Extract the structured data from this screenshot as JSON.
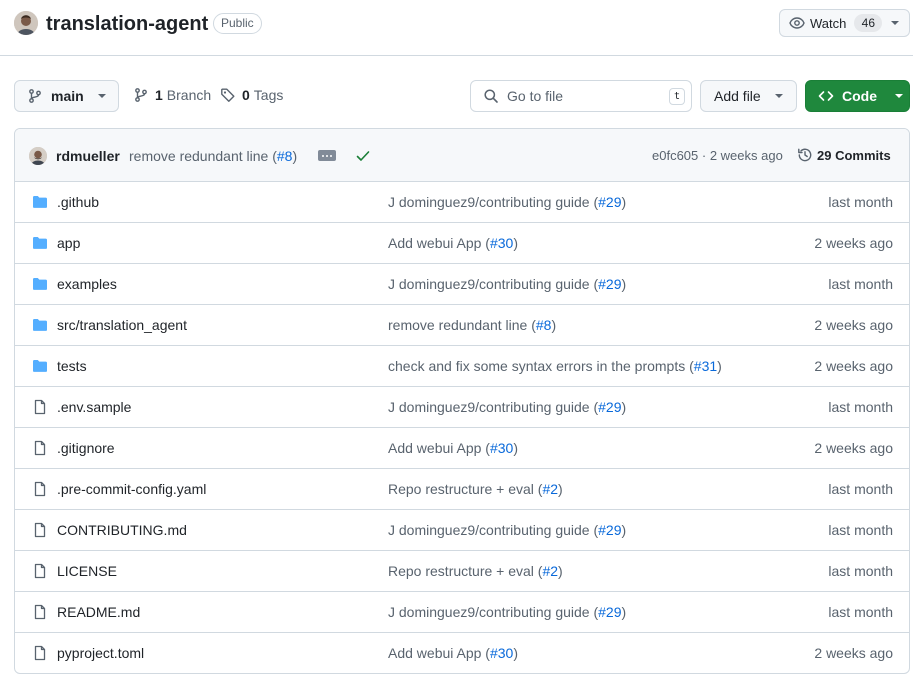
{
  "repo": {
    "name": "translation-agent",
    "visibility": "Public",
    "watch_label": "Watch",
    "watch_count": "46"
  },
  "toolbar": {
    "branch": "main",
    "branches_count": "1",
    "branches_label": "Branch",
    "tags_count": "0",
    "tags_label": "Tags",
    "search_placeholder": "Go to file",
    "search_shortcut": "t",
    "add_file_label": "Add file",
    "code_label": "Code"
  },
  "colors": {
    "accent_link": "#0969da",
    "code_button": "#1f883d",
    "success_check": "#1a7f37",
    "folder_icon": "#54aeff"
  },
  "latest_commit": {
    "author": "rdmueller",
    "message": "remove redundant line (",
    "pr": "#8",
    "message_end": ")",
    "hash_time": "e0fc605 · 2 weeks ago",
    "commits_label": "29 Commits",
    "status_icon": "check-icon"
  },
  "files": [
    {
      "name": ".github",
      "type": "folder",
      "commit": "J dominguez9/contributing guide (",
      "pr": "#29",
      "end": ")",
      "date": "last month"
    },
    {
      "name": "app",
      "type": "folder",
      "commit": "Add webui App (",
      "pr": "#30",
      "end": ")",
      "date": "2 weeks ago"
    },
    {
      "name": "examples",
      "type": "folder",
      "commit": "J dominguez9/contributing guide (",
      "pr": "#29",
      "end": ")",
      "date": "last month"
    },
    {
      "name": "src/translation_agent",
      "type": "folder",
      "commit": "remove redundant line (",
      "pr": "#8",
      "end": ")",
      "date": "2 weeks ago"
    },
    {
      "name": "tests",
      "type": "folder",
      "commit": "check and fix some syntax errors in the prompts (",
      "pr": "#31",
      "end": ")",
      "date": "2 weeks ago"
    },
    {
      "name": ".env.sample",
      "type": "file",
      "commit": "J dominguez9/contributing guide (",
      "pr": "#29",
      "end": ")",
      "date": "last month"
    },
    {
      "name": ".gitignore",
      "type": "file",
      "commit": "Add webui App (",
      "pr": "#30",
      "end": ")",
      "date": "2 weeks ago"
    },
    {
      "name": ".pre-commit-config.yaml",
      "type": "file",
      "commit": "Repo restructure + eval (",
      "pr": "#2",
      "end": ")",
      "date": "last month"
    },
    {
      "name": "CONTRIBUTING.md",
      "type": "file",
      "commit": "J dominguez9/contributing guide (",
      "pr": "#29",
      "end": ")",
      "date": "last month"
    },
    {
      "name": "LICENSE",
      "type": "file",
      "commit": "Repo restructure + eval (",
      "pr": "#2",
      "end": ")",
      "date": "last month"
    },
    {
      "name": "README.md",
      "type": "file",
      "commit": "J dominguez9/contributing guide (",
      "pr": "#29",
      "end": ")",
      "date": "last month"
    },
    {
      "name": "pyproject.toml",
      "type": "file",
      "commit": "Add webui App (",
      "pr": "#30",
      "end": ")",
      "date": "2 weeks ago"
    }
  ]
}
